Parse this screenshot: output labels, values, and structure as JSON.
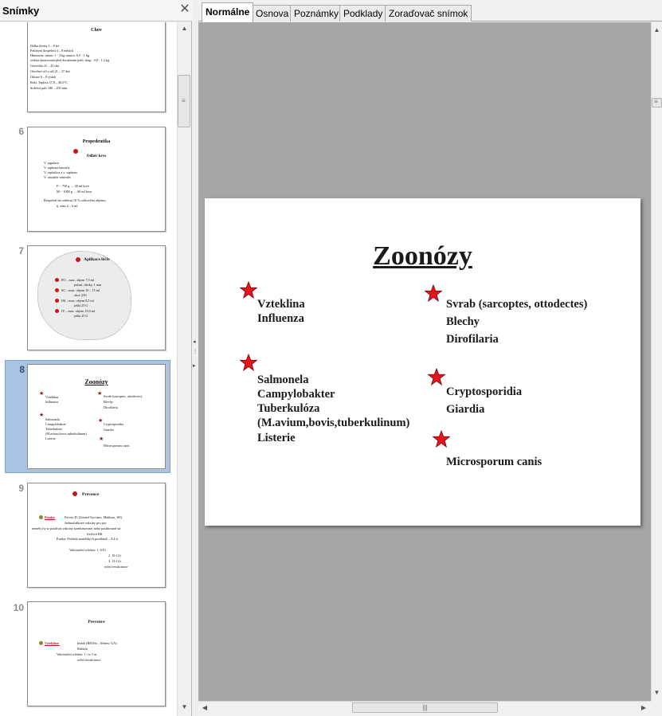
{
  "slide_pane": {
    "title": "Snímky",
    "close_icon": "close-icon",
    "thumbnails": [
      {
        "number": "",
        "title": "Chov",
        "lines": [
          "Délka života        5 – 8 let",
          "Pohlavní dospělost   4 – 8 měsíců",
          "Hmotnost: samec 1 - 2 kg    samice: 0,5 - 1 kg",
          "            zvířata kastrovaná před dosažením pohl. dosp.: 0,8 - 1,2 kg",
          "Gravidita            41 – 42 dní",
          "Otevření očí a uší   21 – 37 dní",
          "Odstav               6 – 8 týdnů",
          "Rekt. Teplota        37,8 – 40,0°C",
          "Srdeční puls         180 – 250 min."
        ]
      },
      {
        "number": "6",
        "title": "Propedeutika",
        "subtitle": "Odběr krve",
        "lines": [
          "V. jugularis",
          "V. saphena lateralis",
          "V. cephalica a v. saphena",
          "V. caudalis ventralis",
          "F:  - 750 g  → 40 ml krve",
          "M: - 1000 g  → 60 ml krve",
          "Bezpečně lze odebrat 10 % celkového objemu,",
          "tj. max 4 – 6 ml"
        ]
      },
      {
        "number": "7",
        "title": "Aplikace léčiv",
        "lines": [
          "PO – max. objem 7,5 ml",
          "pulzní, dávky, 1 mm",
          "SC – max. objem 10 – 15 ml",
          "akce 23G",
          "IM – max. objem 0,5 ml",
          "jehla 25 G",
          "IV – max. objem 10,0 ml",
          "jehla 25 G"
        ]
      },
      {
        "number": "8",
        "title": "Zoonózy",
        "col1": [
          "Vzteklina",
          "Influenza",
          "",
          "Salmonela",
          "Campylobakter",
          "Tuberkulóza",
          "(M.avium,bovis,tuberkulinum)",
          "Listerie"
        ],
        "col2": [
          "Svrab (sarcoptes, ottodectes)",
          "Blechy",
          "Dirofilaria",
          "",
          "Cryptosporidia",
          "Giardia",
          "",
          "Microsporum canis"
        ]
      },
      {
        "number": "9",
        "title": "Prevence",
        "lines": [
          "Fervac-D, (United Vaccines, Madison, WI)",
          "Jednosložkové vakcíny pro psy",
          "neměly by se používat vakcíny kombinované, nebo pasážované na",
          "fretčích BK",
          "Psinka: Počátek mateřských protilátek – 9,4 d",
          "Vakcinační schéma: 1. 6-8 t",
          "2. 10-12 t",
          "3. 13-14 t",
          "roční revakcinace"
        ],
        "keyword": "Psinka:"
      },
      {
        "number": "10",
        "title": "Prevence",
        "lines": [
          "Imrab (RM Inc., Athens, GA)",
          "Rabisin",
          "Vakcinační schéma: 1. ve 3 m",
          "roční revakcinace"
        ],
        "keyword": "Vzteklina:"
      }
    ]
  },
  "tabs": [
    {
      "label": "Normálne",
      "active": true
    },
    {
      "label": "Osnova",
      "active": false
    },
    {
      "label": "Poznámky",
      "active": false
    },
    {
      "label": "Podklady",
      "active": false
    },
    {
      "label": "Zoraďovač snímok",
      "active": false
    }
  ],
  "current_slide": {
    "title": "Zoonózy",
    "left_group_1": [
      "Vzteklina",
      "Influenza"
    ],
    "left_group_2": [
      "Salmonela",
      "Campylobakter",
      "Tuberkulóza",
      "(M.avium,bovis,tuberkulinum)",
      "Listerie"
    ],
    "right_group_1": [
      "Svrab (sarcoptes, ottodectes)",
      "Blechy",
      "Dirofilaria"
    ],
    "right_group_2": [
      "Cryptosporidia",
      "Giardia"
    ],
    "right_group_3": [
      "Microsporum canis"
    ],
    "star_color": "#e8141c"
  },
  "colors": {
    "selection": "#a9c4e2",
    "canvas_bg": "#a6a6a6",
    "star": "#e8141c"
  }
}
